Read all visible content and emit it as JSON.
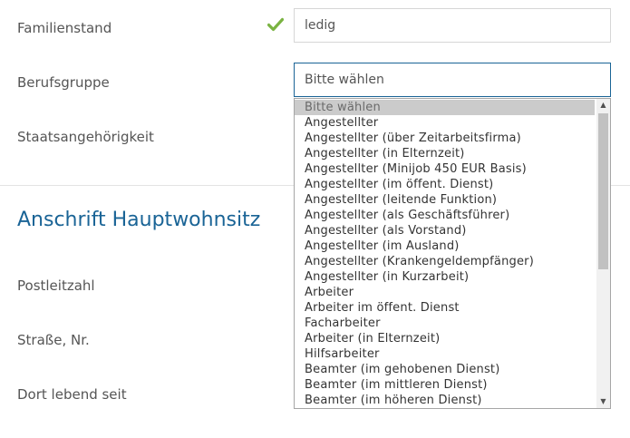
{
  "form": {
    "familienstand": {
      "label": "Familienstand",
      "value": "ledig"
    },
    "berufsgruppe": {
      "label": "Berufsgruppe",
      "value": "Bitte wählen"
    },
    "staatsangehoerigkeit": {
      "label": "Staatsangehörigkeit"
    }
  },
  "section": {
    "title": "Anschrift Hauptwohnsitz"
  },
  "address": {
    "postleitzahl": "Postleitzahl",
    "strasse": "Straße, Nr.",
    "dort_lebend_seit": "Dort lebend seit"
  },
  "dropdown": {
    "selected_index": 0,
    "options": [
      "Bitte wählen",
      "Angestellter",
      "Angestellter (über Zeitarbeitsfirma)",
      "Angestellter (in Elternzeit)",
      "Angestellter (Minijob 450 EUR Basis)",
      "Angestellter (im öffent. Dienst)",
      "Angestellter (leitende Funktion)",
      "Angestellter (als Geschäftsführer)",
      "Angestellter (als Vorstand)",
      "Angestellter (im Ausland)",
      "Angestellter (Krankengeldempfänger)",
      "Angestellter (in Kurzarbeit)",
      "Arbeiter",
      "Arbeiter im öffent. Dienst",
      "Facharbeiter",
      "Arbeiter (in Elternzeit)",
      "Hilfsarbeiter",
      "Beamter (im gehobenen Dienst)",
      "Beamter (im mittleren Dienst)",
      "Beamter (im höheren Dienst)"
    ]
  },
  "icons": {
    "valid": "checkmark-icon",
    "scroll_up": "arrow-up-icon",
    "scroll_down": "arrow-down-icon"
  },
  "colors": {
    "accent": "#1a6496",
    "valid": "#7ab342",
    "selected_bg": "#cbcbcb"
  }
}
